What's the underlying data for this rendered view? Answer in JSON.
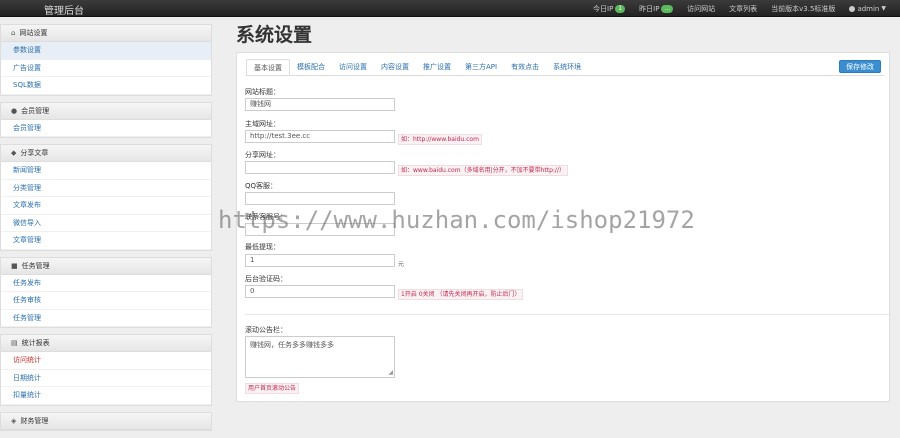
{
  "navbar": {
    "brand": "管理后台",
    "items": [
      {
        "label": "今日IP",
        "badge": "1"
      },
      {
        "label": "昨日IP",
        "badge": "..."
      },
      {
        "label": "访问网站",
        "badge": ""
      },
      {
        "label": "文章列表",
        "badge": ""
      },
      {
        "label": "当前版本v3.5标准版",
        "badge": ""
      }
    ],
    "user": "admin"
  },
  "sidebar": {
    "sections": [
      {
        "title": "网站设置",
        "icon": "home-icon",
        "items": [
          {
            "label": "参数设置",
            "active": true,
            "red": false
          },
          {
            "label": "广告设置",
            "active": false,
            "red": false
          },
          {
            "label": "SQL数据",
            "active": false,
            "red": false
          }
        ]
      },
      {
        "title": "会员管理",
        "icon": "user-icon",
        "items": [
          {
            "label": "会员管理",
            "active": false,
            "red": false
          }
        ]
      },
      {
        "title": "分享文章",
        "icon": "share-icon",
        "items": [
          {
            "label": "新闻管理",
            "active": false,
            "red": false
          },
          {
            "label": "分类管理",
            "active": false,
            "red": false
          },
          {
            "label": "文章发布",
            "active": false,
            "red": false
          },
          {
            "label": "微信导入",
            "active": false,
            "red": false
          },
          {
            "label": "文章管理",
            "active": false,
            "red": false
          }
        ]
      },
      {
        "title": "任务管理",
        "icon": "task-icon",
        "items": [
          {
            "label": "任务发布",
            "active": false,
            "red": false
          },
          {
            "label": "任务审核",
            "active": false,
            "red": false
          },
          {
            "label": "任务管理",
            "active": false,
            "red": false
          }
        ]
      },
      {
        "title": "统计报表",
        "icon": "chart-icon",
        "items": [
          {
            "label": "访问统计",
            "active": false,
            "red": true
          },
          {
            "label": "日期统计",
            "active": false,
            "red": false
          },
          {
            "label": "扣量统计",
            "active": false,
            "red": false
          }
        ]
      },
      {
        "title": "财务管理",
        "icon": "money-icon",
        "items": []
      }
    ]
  },
  "main": {
    "title": "系统设置",
    "tabs": [
      "基本设置",
      "模板配合",
      "访问设置",
      "内容设置",
      "推广设置",
      "第三方API",
      "有效点击",
      "系统环境"
    ],
    "save_label": "保存修改",
    "fields": {
      "site_title": {
        "label": "网站标题：",
        "value": "赚钱网"
      },
      "main_url": {
        "label": "主域网址：",
        "value": "http://test.3ee.cc",
        "hint": "如：http://www.baidu.com"
      },
      "share_url": {
        "label": "分享网址：",
        "value": "",
        "hint": "如：www.baidu.com（多域名用|分开，不加不要带http://）"
      },
      "qq_group": {
        "label": "QQ客服：",
        "value": ""
      },
      "wx_id": {
        "label": "联系客服号：",
        "value": ""
      },
      "min_withdraw": {
        "label": "最低提现：",
        "value": "1",
        "suffix": "元"
      },
      "admin_code": {
        "label": "后台验证码：",
        "value": "0",
        "hint": "1开启 0关闭 （请先关闭再开启，防止后门）"
      },
      "notice": {
        "label": "滚动公告栏：",
        "value": "赚钱网，任务多多赚钱多多",
        "note": "用户首页滚动公告"
      }
    }
  },
  "watermark": "https://www.huzhan.com/ishop21972"
}
